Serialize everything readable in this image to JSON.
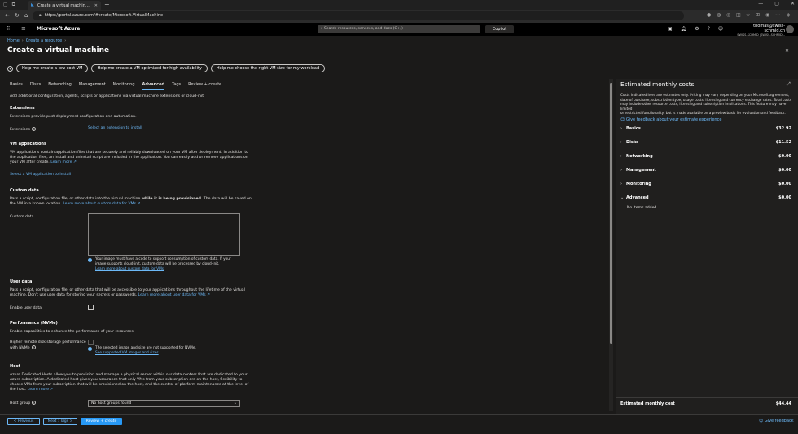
{
  "browser": {
    "tab_title": "Create a virtual machine - Micro",
    "url": "https://portal.azure.com/#create/Microsoft.VirtualMachine"
  },
  "azure": {
    "brand": "Microsoft Azure",
    "search_placeholder": "Search resources, services, and docs (G+/)",
    "copilot": "Copilot",
    "user_email": "thomas@swiss-schmid.ch",
    "user_tenant": "SWISS-SCHMID (SWISS-SCHMID..."
  },
  "breadcrumb": [
    "Home",
    "Create a resource"
  ],
  "page_title": "Create a virtual machine",
  "help_buttons": [
    "Help me create a low cost VM",
    "Help me create a VM optimized for high availability",
    "Help me choose the right VM size for my workload"
  ],
  "tabs": [
    "Basics",
    "Disks",
    "Networking",
    "Management",
    "Monitoring",
    "Advanced",
    "Tags",
    "Review + create"
  ],
  "active_tab": "Advanced",
  "intro": "Add additional configuration, agents, scripts or applications via virtual machine extensions or cloud-init.",
  "extensions": {
    "heading": "Extensions",
    "desc": "Extensions provide post-deployment configuration and automation.",
    "label": "Extensions",
    "link": "Select an extension to install"
  },
  "vm_apps": {
    "heading": "VM applications",
    "desc_1": "VM applications contain application files that are securely and reliably downloaded on your VM after deployment. In addition to",
    "desc_2": "the application files, an install and uninstall script are included in the application. You can easily add or remove applications on",
    "desc_3": "your VM after create.",
    "learn_more": "Learn more",
    "link": "Select a VM application to install"
  },
  "custom_data": {
    "heading": "Custom data",
    "desc_1a": "Pass a script, configuration file, or other data into the virtual machine ",
    "desc_1b": "while it is being provisioned",
    "desc_1c": ". The data will be saved on",
    "desc_2": "the VM in a known location.",
    "learn_more": "Learn more about custom data for VMs",
    "label": "Custom data",
    "info_1": "Your image must have a code to support consumption of custom data. If your",
    "info_2": "image supports cloud-init, custom-data will be processed by cloud-init.",
    "info_link": "Learn more about custom data for VMs"
  },
  "user_data": {
    "heading": "User data",
    "desc_1": "Pass a script, configuration file, or other data that will be accessible to your applications throughout the lifetime of the virtual",
    "desc_2": "machine. Don't use user data for storing your secrets or passwords.",
    "learn_more": "Learn more about user data for VMs",
    "label": "Enable user data"
  },
  "nvme": {
    "heading": "Performance (NVMe)",
    "desc": "Enable capabilities to enhance the performance of your resources.",
    "label_1": "Higher remote disk storage performance",
    "label_2": "with NVMe",
    "info": "The selected image and size are not supported for NVMe.",
    "info_link": "See supported VM images and sizes"
  },
  "host": {
    "heading": "Host",
    "desc_1": "Azure Dedicated Hosts allow you to provision and manage a physical server within our data centers that are dedicated to your",
    "desc_2": "Azure subscription. A dedicated host gives you assurance that only VMs from your subscription are on the host, flexibility to",
    "desc_3": "choose VMs from your subscription that will be provisioned on the host, and the control of platform maintenance at the level of",
    "desc_4": "the host.",
    "learn_more": "Learn more",
    "label": "Host group",
    "value": "No host groups found"
  },
  "cost": {
    "title": "Estimated monthly costs",
    "desc_1": "Costs indicated here are estimates only. Pricing may vary depending on your Microsoft agreement,",
    "desc_2": "date of purchase, subscription type, usage costs, licensing and currency exchange rates. Total costs",
    "desc_3": "may include other resource costs, licensing and subscription implications. This feature may have limited",
    "desc_4": "or restricted functionality, but is made available on a preview basis for evaluation and feedback.",
    "feedback": "Give feedback about your estimate experience",
    "rows": [
      {
        "label": "Basics",
        "value": "$32.92"
      },
      {
        "label": "Disks",
        "value": "$11.52"
      },
      {
        "label": "Networking",
        "value": "$0.00"
      },
      {
        "label": "Management",
        "value": "$0.00"
      },
      {
        "label": "Monitoring",
        "value": "$0.00"
      },
      {
        "label": "Advanced",
        "value": "$0.00"
      }
    ],
    "no_items": "No items added",
    "total_label": "Estimated monthly cost",
    "total_value": "$44.44"
  },
  "footer": {
    "previous": "< Previous",
    "next": "Next : Tags >",
    "review": "Review + create",
    "give_feedback": "Give feedback"
  }
}
